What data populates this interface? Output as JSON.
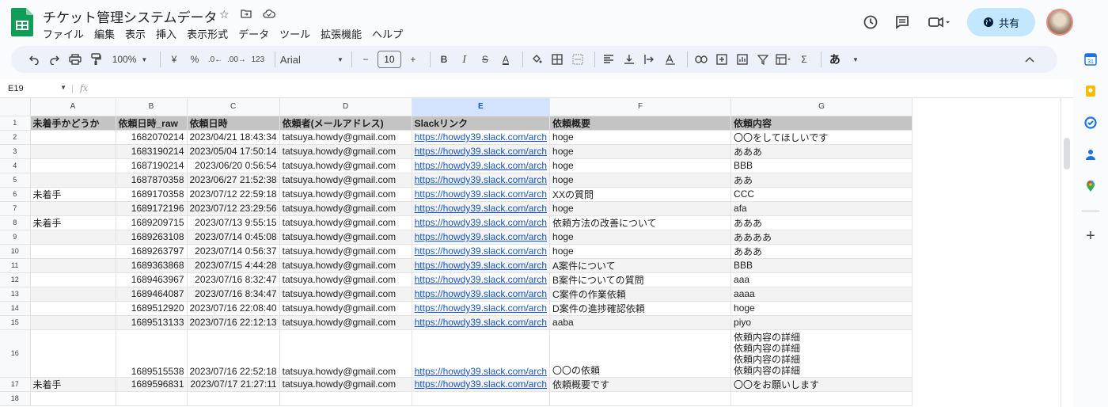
{
  "doc": {
    "title": "チケット管理システムデータ",
    "menu": [
      "ファイル",
      "編集",
      "表示",
      "挿入",
      "表示形式",
      "データ",
      "ツール",
      "拡張機能",
      "ヘルプ"
    ],
    "share_label": "共有"
  },
  "toolbar": {
    "zoom": "100%",
    "currency": "¥",
    "percent": "%",
    "dec_decrease": ".0←",
    "dec_increase": ".00→",
    "number_format": "123",
    "font": "Arial",
    "font_size": "10",
    "minus": "−",
    "plus": "+",
    "bold": "B",
    "italic": "I",
    "strike": "S",
    "text_color": "A",
    "sigma": "Σ",
    "input_tools": "あ"
  },
  "formula_bar": {
    "cell_ref": "E19",
    "fx": "fx"
  },
  "sidebar_icons": [
    "calendar-icon",
    "keep-icon",
    "tasks-icon",
    "contacts-icon",
    "maps-icon",
    "add-icon"
  ],
  "grid": {
    "columns": [
      "A",
      "B",
      "C",
      "D",
      "E",
      "F",
      "G"
    ],
    "selected_column": "E",
    "header_row": [
      "未着手かどうか",
      "依頼日時_raw",
      "依頼日時",
      "依頼者(メールアドレス)",
      "Slackリンク",
      "依頼概要",
      "依頼内容"
    ],
    "rows": [
      {
        "n": "2",
        "a": "",
        "b": "1682070214",
        "c": "2023/04/21 18:43:34",
        "d": "tatsuya.howdy@gmail.com",
        "e": "https://howdy39.slack.com/arch",
        "f": "hoge",
        "g": "〇〇をしてほしいです"
      },
      {
        "n": "3",
        "a": "",
        "b": "1683190214",
        "c": "2023/05/04 17:50:14",
        "d": "tatsuya.howdy@gmail.com",
        "e": "https://howdy39.slack.com/arch",
        "f": "hoge",
        "g": "あああ"
      },
      {
        "n": "4",
        "a": "",
        "b": "1687190214",
        "c": "2023/06/20 0:56:54",
        "d": "tatsuya.howdy@gmail.com",
        "e": "https://howdy39.slack.com/arch",
        "f": "hoge",
        "g": "BBB"
      },
      {
        "n": "5",
        "a": "",
        "b": "1687870358",
        "c": "2023/06/27 21:52:38",
        "d": "tatsuya.howdy@gmail.com",
        "e": "https://howdy39.slack.com/arch",
        "f": "hoge",
        "g": "ああ"
      },
      {
        "n": "6",
        "a": "未着手",
        "b": "1689170358",
        "c": "2023/07/12 22:59:18",
        "d": "tatsuya.howdy@gmail.com",
        "e": "https://howdy39.slack.com/arch",
        "f": "XXの質問",
        "g": "CCC"
      },
      {
        "n": "7",
        "a": "",
        "b": "1689172196",
        "c": "2023/07/12 23:29:56",
        "d": "tatsuya.howdy@gmail.com",
        "e": "https://howdy39.slack.com/arch",
        "f": "hoge",
        "g": "afa"
      },
      {
        "n": "8",
        "a": "未着手",
        "b": "1689209715",
        "c": "2023/07/13 9:55:15",
        "d": "tatsuya.howdy@gmail.com",
        "e": "https://howdy39.slack.com/arch",
        "f": "依頼方法の改善について",
        "g": "あああ"
      },
      {
        "n": "9",
        "a": "",
        "b": "1689263108",
        "c": "2023/07/14 0:45:08",
        "d": "tatsuya.howdy@gmail.com",
        "e": "https://howdy39.slack.com/arch",
        "f": "hoge",
        "g": "ああああ"
      },
      {
        "n": "10",
        "a": "",
        "b": "1689263797",
        "c": "2023/07/14 0:56:37",
        "d": "tatsuya.howdy@gmail.com",
        "e": "https://howdy39.slack.com/arch",
        "f": "hoge",
        "g": "あああ"
      },
      {
        "n": "11",
        "a": "",
        "b": "1689363868",
        "c": "2023/07/15 4:44:28",
        "d": "tatsuya.howdy@gmail.com",
        "e": "https://howdy39.slack.com/arch",
        "f": "A案件について",
        "g": "BBB"
      },
      {
        "n": "12",
        "a": "",
        "b": "1689463967",
        "c": "2023/07/16 8:32:47",
        "d": "tatsuya.howdy@gmail.com",
        "e": "https://howdy39.slack.com/arch",
        "f": "B案件についての質問",
        "g": "aaa"
      },
      {
        "n": "13",
        "a": "",
        "b": "1689464087",
        "c": "2023/07/16 8:34:47",
        "d": "tatsuya.howdy@gmail.com",
        "e": "https://howdy39.slack.com/arch",
        "f": "C案件の作業依頼",
        "g": "aaaa"
      },
      {
        "n": "14",
        "a": "",
        "b": "1689512920",
        "c": "2023/07/16 22:08:40",
        "d": "tatsuya.howdy@gmail.com",
        "e": "https://howdy39.slack.com/arch",
        "f": "D案件の進捗確認依頼",
        "g": "hoge"
      },
      {
        "n": "15",
        "a": "",
        "b": "1689513133",
        "c": "2023/07/16 22:12:13",
        "d": "tatsuya.howdy@gmail.com",
        "e": "https://howdy39.slack.com/arch",
        "f": "aaba",
        "g": "piyo"
      },
      {
        "n": "16",
        "a": "",
        "b": "1689515538",
        "c": "2023/07/16 22:52:18",
        "d": "tatsuya.howdy@gmail.com",
        "e": "https://howdy39.slack.com/arch",
        "f": "〇〇の依頼",
        "g": "依頼内容の詳細\n依頼内容の詳細\n依頼内容の詳細\n依頼内容の詳細"
      },
      {
        "n": "17",
        "a": "未着手",
        "b": "1689596831",
        "c": "2023/07/17 21:27:11",
        "d": "tatsuya.howdy@gmail.com",
        "e": "https://howdy39.slack.com/arch",
        "f": "依頼概要です",
        "g": "〇〇をお願いします"
      },
      {
        "n": "18",
        "a": "",
        "b": "",
        "c": "",
        "d": "",
        "e": "",
        "f": "",
        "g": ""
      }
    ]
  }
}
